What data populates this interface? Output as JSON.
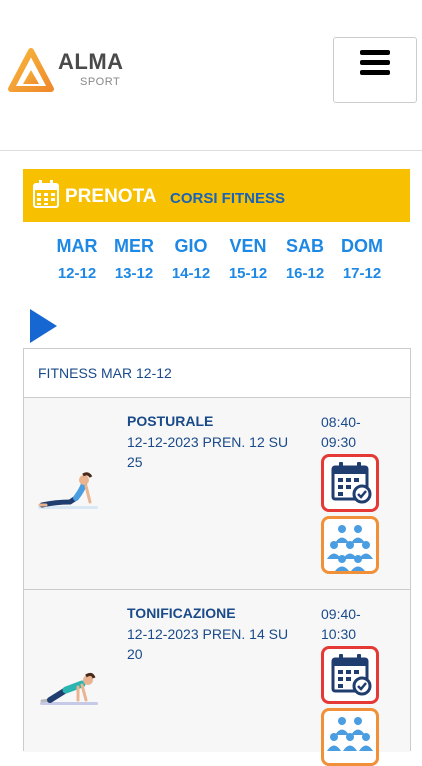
{
  "header": {
    "brand": "ALMA",
    "brand_sub": "SPORT"
  },
  "banner": {
    "title": "PRENOTA",
    "subtitle": "CORSI FITNESS"
  },
  "days": [
    {
      "name": "MAR",
      "date": "12-12"
    },
    {
      "name": "MER",
      "date": "13-12"
    },
    {
      "name": "GIO",
      "date": "14-12"
    },
    {
      "name": "VEN",
      "date": "15-12"
    },
    {
      "name": "SAB",
      "date": "16-12"
    },
    {
      "name": "DOM",
      "date": "17-12"
    }
  ],
  "panel": {
    "title": "FITNESS MAR 12-12"
  },
  "classes": [
    {
      "name": "POSTURALE",
      "info": "12-12-2023 PREN. 12 SU 25",
      "time": "08:40-09:30"
    },
    {
      "name": "TONIFICAZIONE",
      "info": "12-12-2023 PREN. 14 SU 20",
      "time": "09:40-10:30"
    }
  ],
  "colors": {
    "accent_yellow": "#f7c000",
    "day_blue": "#1e88e5",
    "text_navy": "#1a4a8a",
    "book_border": "#e53935",
    "people_border": "#f0913a"
  }
}
